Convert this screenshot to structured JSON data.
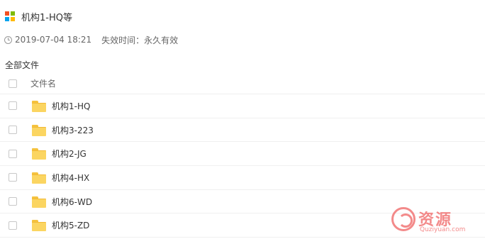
{
  "share": {
    "title": "机构1-HQ等",
    "date": "2019-07-04 18:21",
    "expire_label": "失效时间：",
    "expire_value": "永久有效"
  },
  "breadcrumb": "全部文件",
  "columns": {
    "name": "文件名"
  },
  "files": [
    {
      "name": "机构1-HQ"
    },
    {
      "name": "机构3-223"
    },
    {
      "name": "机构2-JG"
    },
    {
      "name": "机构4-HX"
    },
    {
      "name": "机构6-WD"
    },
    {
      "name": "机构5-ZD"
    }
  ],
  "watermark": {
    "text": "资源",
    "sub": "Quziyuan.com"
  },
  "colors": {
    "logo": [
      "#f25022",
      "#7fba00",
      "#00a4ef",
      "#ffb900"
    ],
    "folder": "#fbd561",
    "watermark": "#f06464"
  }
}
